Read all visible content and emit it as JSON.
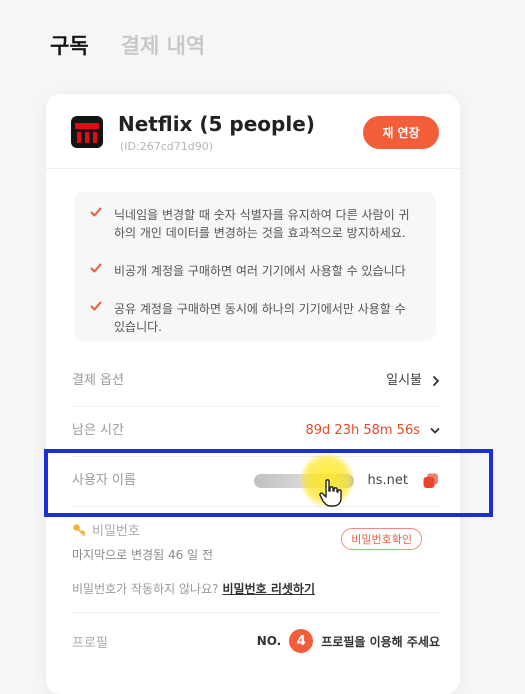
{
  "tabs": [
    {
      "label": "구독",
      "active": true
    },
    {
      "label": "결제 내역",
      "active": false
    }
  ],
  "subscription": {
    "service_name": "Netflix (5 people)",
    "service_id": "(ID:267cd71d90)",
    "logo_icon": "netflix-logo",
    "renew_label": "재 연장"
  },
  "notices": [
    "닉네임을 변경할 때 숫자 식별자를 유지하여 다른 사람이 귀하의 개인 데이터를 변경하는 것을 효과적으로 방지하세요.",
    "비공개 계정을 구매하면 여러 기기에서 사용할 수 있습니다",
    "공유 계정을 구매하면 동시에 하나의 기기에서만 사용할 수 있습니다."
  ],
  "payment_option": {
    "label": "결제 옵션",
    "value": "일시불"
  },
  "remaining_time": {
    "label": "남은 시간",
    "value": "89d 23h 58m 56s"
  },
  "username": {
    "label": "사용자 이름",
    "value_suffix": "hs.net"
  },
  "password": {
    "label": "비밀번호",
    "last_changed": "마지막으로 변경됨 46 일 전",
    "confirm_label": "비밀번호확인",
    "not_working": "비밀번호가 작동하지 않나요?",
    "reset_link": "비밀번호 리셋하기"
  },
  "profile": {
    "label": "프로필",
    "no_prefix": "NO.",
    "number": "4",
    "message": "프로필을 이용해 주세요"
  },
  "colors": {
    "accent": "#f25d3a",
    "highlight_box": "#1a2fd6",
    "time_red": "#e44a2a"
  }
}
